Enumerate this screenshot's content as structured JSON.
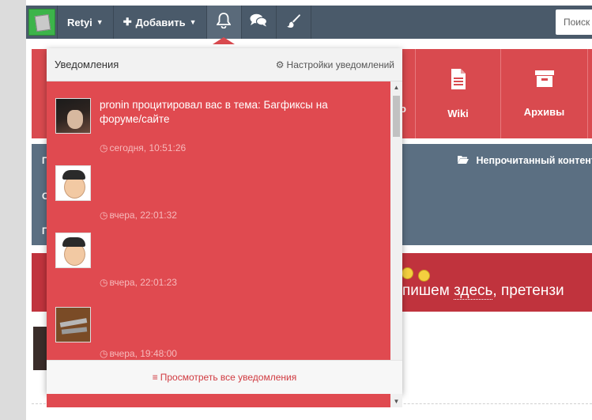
{
  "navbar": {
    "username": "Retyi",
    "add_label": "Добавить",
    "search_placeholder": "Поиск",
    "icons": [
      "bell-icon",
      "chat-icon",
      "brush-icon"
    ]
  },
  "background": {
    "tiles": [
      {
        "label": "о",
        "icon": "file-icon"
      },
      {
        "label": "Wiki",
        "icon": "document-icon"
      },
      {
        "label": "Архивы",
        "icon": "archive-icon"
      }
    ],
    "unread_link": "Непрочитанный контент",
    "slate_letters": [
      "П",
      "С",
      "П"
    ],
    "banner_text_before": "пишем ",
    "banner_text_link": "здесь",
    "banner_text_after": ", претензи"
  },
  "notifications": {
    "title": "Уведомления",
    "settings_label": "Настройки уведомлений",
    "footer_label": "Просмотреть все уведомления",
    "items": [
      {
        "text": "pronin процитировал вас в тема: Багфиксы на форуме/сайте",
        "time": "сегодня, 10:51:26",
        "avatar": "anime-avatar"
      },
      {
        "text": "",
        "time": "вчера, 22:01:32",
        "avatar": "cartoon-face-avatar"
      },
      {
        "text": "",
        "time": "вчера, 22:01:23",
        "avatar": "cartoon-face-avatar"
      },
      {
        "text": "",
        "time": "вчера, 19:48:00",
        "avatar": "guns-avatar"
      }
    ]
  },
  "colors": {
    "navbar": "#4a5a6a",
    "accent_red": "#d94a4f",
    "list_red": "#e04a50",
    "banner_red": "#c0333d",
    "slate": "#5b6f82"
  }
}
